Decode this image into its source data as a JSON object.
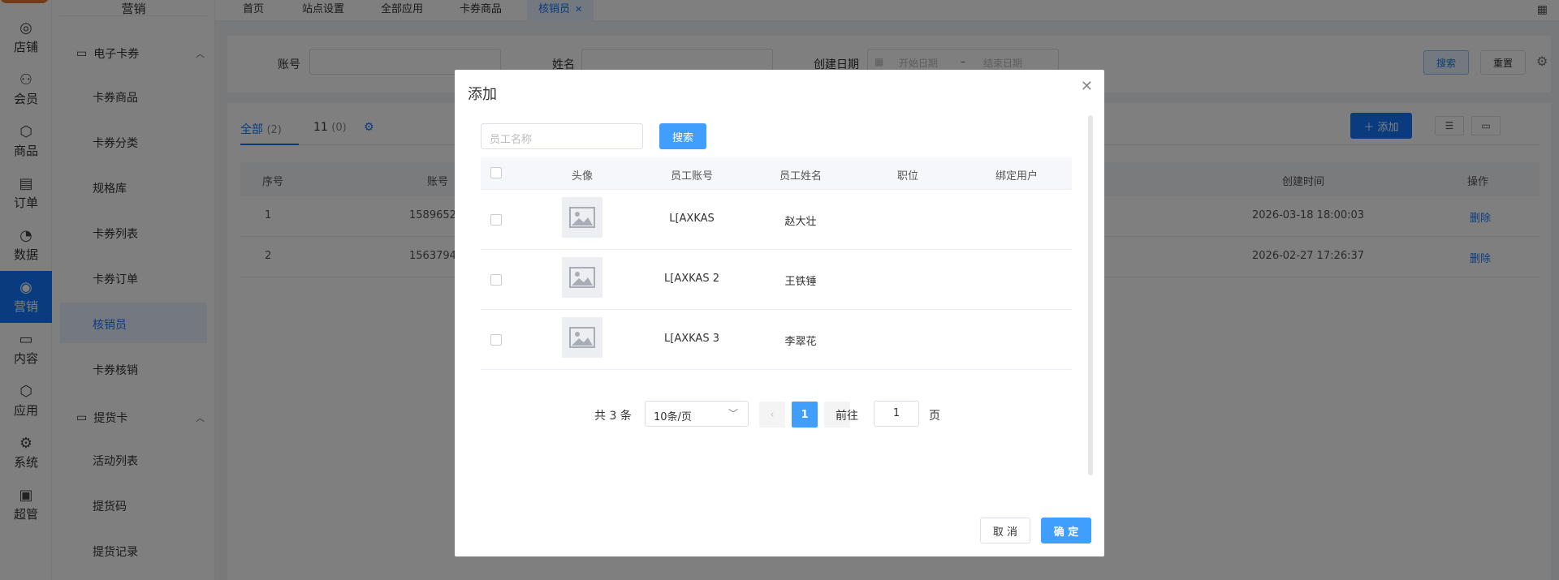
{
  "rail": {
    "items": [
      {
        "label": "店铺",
        "icon": "store-icon"
      },
      {
        "label": "会员",
        "icon": "user-icon"
      },
      {
        "label": "商品",
        "icon": "box-icon"
      },
      {
        "label": "订单",
        "icon": "clipboard-icon"
      },
      {
        "label": "数据",
        "icon": "pie-chart-icon"
      },
      {
        "label": "营销",
        "icon": "target-icon"
      },
      {
        "label": "内容",
        "icon": "folder-icon"
      },
      {
        "label": "应用",
        "icon": "cube-icon"
      },
      {
        "label": "系统",
        "icon": "gear-icon"
      },
      {
        "label": "超管",
        "icon": "briefcase-icon"
      }
    ],
    "active_index": 5,
    "active_color": "#1677ff"
  },
  "sidebar": {
    "title": "营销",
    "group1": "电子卡券",
    "group1_items": [
      "卡券商品",
      "卡券分类",
      "规格库",
      "卡券列表",
      "卡券订单",
      "核销员",
      "卡券核销"
    ],
    "group2": "提货卡",
    "group2_items": [
      "活动列表",
      "提货码",
      "提货记录"
    ],
    "active_item": "核销员"
  },
  "tabs": [
    {
      "label": "首页"
    },
    {
      "label": "站点设置"
    },
    {
      "label": "全部应用"
    },
    {
      "label": "卡券商品"
    },
    {
      "label": "核销员"
    }
  ],
  "filter": {
    "account_label": "账号",
    "name_label": "姓名",
    "date_label": "创建日期",
    "start_placeholder": "开始日期",
    "date_sep": "–",
    "end_placeholder": "结束日期",
    "search": "搜索",
    "reset": "重置"
  },
  "content": {
    "tab_all": "全部",
    "tab_all_count": "(2)",
    "tab_11": "11",
    "tab_11_count": "(0)",
    "add_button": "添加",
    "columns": {
      "seq": "序号",
      "account": "账号",
      "created": "创建时间",
      "ops": "操作"
    },
    "rows": [
      {
        "seq": "1",
        "account": "1589652",
        "created": "2026-03-18 18:00:03",
        "op": "删除"
      },
      {
        "seq": "2",
        "account": "1563794",
        "created": "2026-02-27 17:26:37",
        "op": "删除"
      }
    ]
  },
  "modal": {
    "title": "添加",
    "search_placeholder": "员工名称",
    "search_button": "搜索",
    "columns": {
      "avatar": "头像",
      "account": "员工账号",
      "name": "员工姓名",
      "position": "职位",
      "bind": "绑定用户"
    },
    "rows": [
      {
        "account": "L[AXKAS",
        "name": "赵大壮",
        "position": "",
        "bind": ""
      },
      {
        "account": "L[AXKAS 2",
        "name": "王铁锤",
        "position": "",
        "bind": ""
      },
      {
        "account": "L[AXKAS 3",
        "name": "李翠花",
        "position": "",
        "bind": ""
      }
    ],
    "pager": {
      "total": "共 3 条",
      "page_size": "10条/页",
      "current": "1",
      "goto_label": "前往",
      "goto_value": "1",
      "page_suffix": "页"
    },
    "cancel": "取 消",
    "confirm": "确 定"
  }
}
